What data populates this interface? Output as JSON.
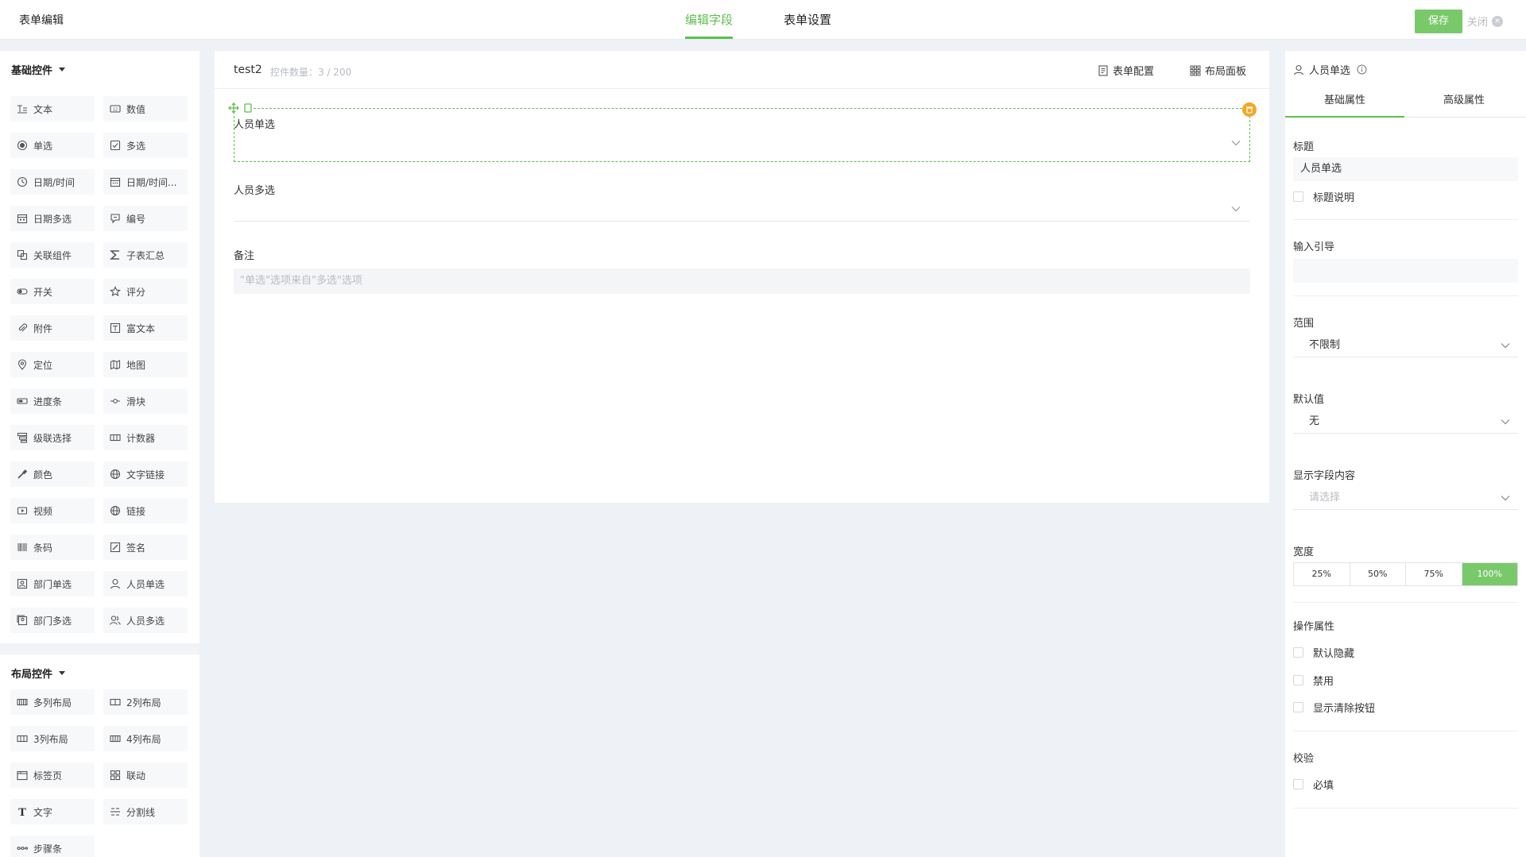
{
  "header": {
    "title": "表单编辑",
    "tabs": [
      "编辑字段",
      "表单设置"
    ],
    "save_label": "保存",
    "close_label": "关闭"
  },
  "left_panel": {
    "basic_title": "基础控件",
    "basic_items": [
      {
        "label": "文本",
        "icon": "text-icon"
      },
      {
        "label": "数值",
        "icon": "number-icon"
      },
      {
        "label": "单选",
        "icon": "radio-icon"
      },
      {
        "label": "多选",
        "icon": "checkbox-icon"
      },
      {
        "label": "日期/时间",
        "icon": "clock-icon"
      },
      {
        "label": "日期/时间...",
        "icon": "calendar-range-icon"
      },
      {
        "label": "日期多选",
        "icon": "calendar-icon"
      },
      {
        "label": "编号",
        "icon": "serial-icon"
      },
      {
        "label": "关联组件",
        "icon": "link-component-icon"
      },
      {
        "label": "子表汇总",
        "icon": "sigma-icon"
      },
      {
        "label": "开关",
        "icon": "toggle-icon"
      },
      {
        "label": "评分",
        "icon": "star-icon"
      },
      {
        "label": "附件",
        "icon": "paperclip-icon"
      },
      {
        "label": "富文本",
        "icon": "rich-text-icon"
      },
      {
        "label": "定位",
        "icon": "location-icon"
      },
      {
        "label": "地图",
        "icon": "map-icon"
      },
      {
        "label": "进度条",
        "icon": "progress-icon"
      },
      {
        "label": "滑块",
        "icon": "slider-icon"
      },
      {
        "label": "级联选择",
        "icon": "cascade-icon"
      },
      {
        "label": "计数器",
        "icon": "counter-icon"
      },
      {
        "label": "颜色",
        "icon": "eyedropper-icon"
      },
      {
        "label": "文字链接",
        "icon": "globe-icon"
      },
      {
        "label": "视频",
        "icon": "video-icon"
      },
      {
        "label": "链接",
        "icon": "globe-icon"
      },
      {
        "label": "条码",
        "icon": "barcode-icon"
      },
      {
        "label": "签名",
        "icon": "signature-icon"
      },
      {
        "label": "部门单选",
        "icon": "department-icon"
      },
      {
        "label": "人员单选",
        "icon": "user-icon"
      },
      {
        "label": "部门多选",
        "icon": "departments-icon"
      },
      {
        "label": "人员多选",
        "icon": "users-icon"
      }
    ],
    "layout_title": "布局控件",
    "layout_items": [
      {
        "label": "多列布局",
        "icon": "multi-column-icon"
      },
      {
        "label": "2列布局",
        "icon": "two-column-icon"
      },
      {
        "label": "3列布局",
        "icon": "three-column-icon"
      },
      {
        "label": "4列布局",
        "icon": "four-column-icon"
      },
      {
        "label": "标签页",
        "icon": "tabs-icon"
      },
      {
        "label": "联动",
        "icon": "linkage-icon"
      },
      {
        "label": "文字",
        "icon": "text-t-icon"
      },
      {
        "label": "分割线",
        "icon": "divider-icon"
      },
      {
        "label": "步骤条",
        "icon": "steps-icon"
      }
    ]
  },
  "canvas": {
    "form_name": "test2",
    "control_count": "控件数量：3 / 200",
    "form_config_label": "表单配置",
    "layout_panel_label": "布局面板",
    "fields": {
      "person_single": "人员单选",
      "person_multi": "人员多选",
      "remark": "备注",
      "remark_placeholder": "\"单选\"选项来自\"多选\"选项"
    }
  },
  "right_panel": {
    "title": "人员单选",
    "tabs": [
      "基础属性",
      "高级属性"
    ],
    "title_label": "标题",
    "title_value": "人员单选",
    "title_desc_label": "标题说明",
    "guide_label": "输入引导",
    "guide_value": "",
    "range_label": "范围",
    "range_value": "不限制",
    "default_label": "默认值",
    "default_value": "无",
    "display_label": "显示字段内容",
    "display_placeholder": "请选择",
    "width_label": "宽度",
    "width_options": [
      "25%",
      "50%",
      "75%",
      "100%"
    ],
    "width_selected": "100%",
    "ops_label": "操作属性",
    "ops": [
      "默认隐藏",
      "禁用",
      "显示清除按钮"
    ],
    "validation_label": "校验",
    "required_label": "必填"
  },
  "colors": {
    "accent": "#5fbe50",
    "save_button": "#79c96b",
    "delete_badge": "#f5a623",
    "background": "#eef1f6"
  }
}
